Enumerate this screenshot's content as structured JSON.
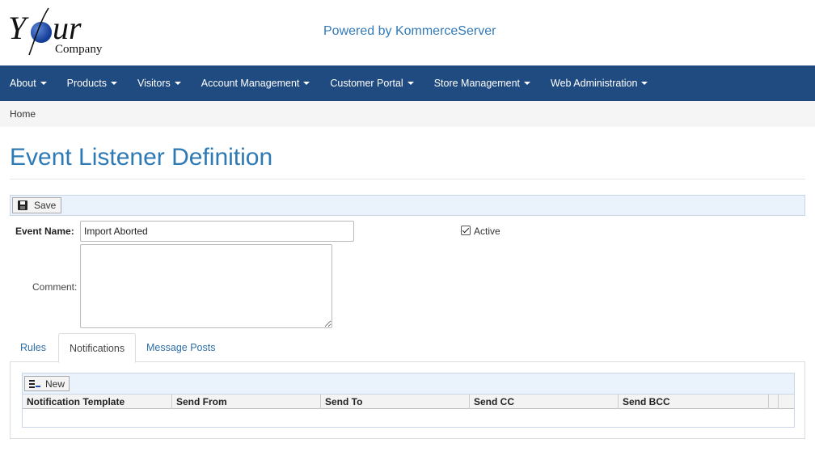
{
  "header": {
    "logo_main": "Your",
    "logo_sub": "Company",
    "powered_by": "Powered by KommerceServer"
  },
  "nav": {
    "items": [
      {
        "label": "About"
      },
      {
        "label": "Products"
      },
      {
        "label": "Visitors"
      },
      {
        "label": "Account Management"
      },
      {
        "label": "Customer Portal"
      },
      {
        "label": "Store Management"
      },
      {
        "label": "Web Administration"
      }
    ]
  },
  "breadcrumb": {
    "home": "Home"
  },
  "page": {
    "title": "Event Listener Definition"
  },
  "toolbar": {
    "save_label": "Save"
  },
  "form": {
    "event_name_label": "Event Name:",
    "event_name_value": "Import Aborted",
    "active_label": "Active",
    "active_checked": true,
    "comment_label": "Comment:",
    "comment_value": ""
  },
  "tabs": [
    {
      "label": "Rules",
      "active": false
    },
    {
      "label": "Notifications",
      "active": true
    },
    {
      "label": "Message Posts",
      "active": false
    }
  ],
  "grid": {
    "new_label": "New",
    "columns": [
      "Notification Template",
      "Send From",
      "Send To",
      "Send CC",
      "Send BCC"
    ]
  },
  "colors": {
    "navbar": "#1f4b80",
    "title": "#2e7ab5",
    "link": "#2f6fa6"
  },
  "icons": {
    "save": "floppy-disk-icon",
    "new": "new-item-icon",
    "nav_dropdown": "caret-down-icon"
  }
}
